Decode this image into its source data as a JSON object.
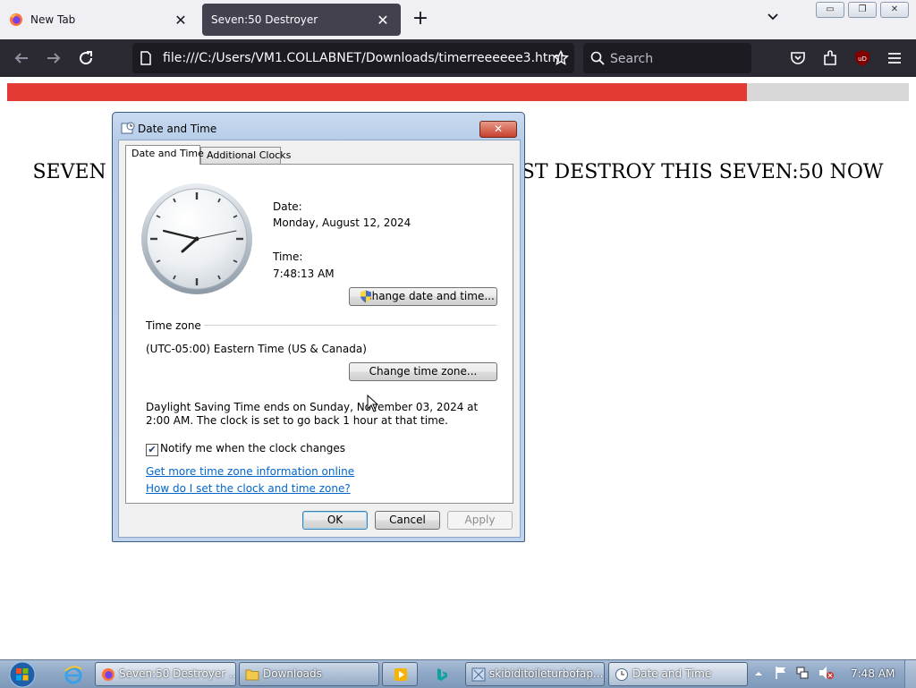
{
  "browser": {
    "tabs": [
      {
        "title": "New Tab",
        "active": false
      },
      {
        "title": "Seven:50 Destroyer",
        "active": true
      }
    ],
    "url": "file:///C:/Users/VM1.COLLABNET/Downloads/timerreeeeee3.html",
    "search_placeholder": "Search",
    "ublock_badge": "uD"
  },
  "page": {
    "progress": 0.82,
    "headline_left": "SEVEN",
    "headline_right": "ST DESTROY THIS SEVEN:50 NOW"
  },
  "dialog": {
    "title": "Date and Time",
    "tabs": [
      "Date and Time",
      "Additional Clocks"
    ],
    "date_label": "Date:",
    "date_value": "Monday, August 12, 2024",
    "time_label": "Time:",
    "time_value": "7:48:13 AM",
    "change_datetime_button": "Change date and time...",
    "timezone_heading": "Time zone",
    "timezone_value": "(UTC-05:00) Eastern Time (US & Canada)",
    "change_timezone_button": "Change time zone...",
    "dst_text": "Daylight Saving Time ends on Sunday, November 03, 2024 at 2:00 AM. The clock is set to go back 1 hour at that time.",
    "notify_checked": true,
    "notify_label": "Notify me when the clock changes",
    "link_more_info": "Get more time zone information online",
    "link_how_to": "How do I set the clock and time zone?",
    "ok": "OK",
    "cancel": "Cancel",
    "apply": "Apply"
  },
  "taskbar": {
    "buttons": [
      {
        "label": "Seven:50 Destroyer ...",
        "icon": "firefox-icon"
      },
      {
        "label": "Downloads",
        "icon": "folder-icon"
      },
      {
        "label": "",
        "icon": "media-player-icon"
      },
      {
        "label": "",
        "icon": "bing-icon"
      },
      {
        "label": "skibiditoileturbofap...",
        "icon": "app-icon"
      },
      {
        "label": "Date and Time",
        "icon": "clock-icon"
      }
    ],
    "clock": "7:48 AM"
  },
  "colors": {
    "progress_fill": "#e53935",
    "progress_track": "#d8d8d8",
    "browser_dark": "#2b2a33",
    "link": "#0066cc"
  }
}
